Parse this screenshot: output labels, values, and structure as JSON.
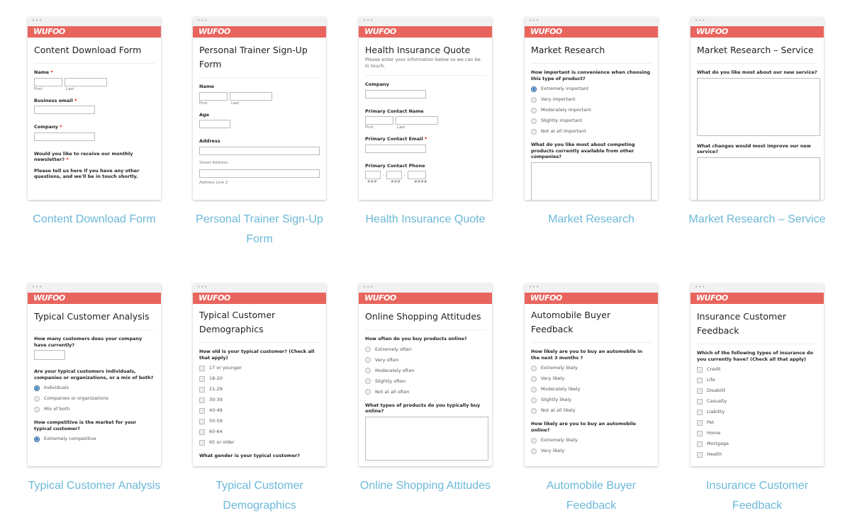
{
  "brand": {
    "logo_text": "WUFOO",
    "bar_color": "#e8655e",
    "caption_color": "#6bb8d8"
  },
  "templates": [
    {
      "caption": "Content Download Form",
      "form_title": "Content Download Form",
      "fields": [
        {
          "label": "Name",
          "required": "*",
          "first": "First",
          "last": "Last"
        },
        {
          "label": "Business email",
          "required": "*"
        },
        {
          "label": "Company",
          "required": "*"
        },
        {
          "label": "Would you like to receive our monthly newsletter?",
          "required": "*"
        },
        {
          "label": "Please tell us here if you have any other questions, and we'll be in touch shortly."
        }
      ]
    },
    {
      "caption": "Personal Trainer Sign-Up Form",
      "form_title": "Personal Trainer Sign-Up Form",
      "fields": [
        {
          "label": "Name",
          "first": "First",
          "last": "Last"
        },
        {
          "label": "Age"
        },
        {
          "label": "Address",
          "street": "Street Address",
          "line2": "Address Line 2"
        }
      ]
    },
    {
      "caption": "Health Insurance Quote",
      "form_title": "Health Insurance Quote",
      "description": "Please enter your information below so we can be in touch.",
      "fields": [
        {
          "label": "Company"
        },
        {
          "label": "Primary Contact Name",
          "first": "First",
          "last": "Last"
        },
        {
          "label": "Primary Contact Email",
          "required": "*"
        },
        {
          "label": "Primary Contact Phone",
          "p1": "###",
          "p2": "###",
          "p3": "####",
          "sep": "-"
        }
      ]
    },
    {
      "caption": "Market Research",
      "form_title": "Market Research",
      "fields": [
        {
          "label": "How important is convenience when choosing this type of product?",
          "options": [
            "Extremely important",
            "Very important",
            "Moderately important",
            "Slightly important",
            "Not at all important"
          ],
          "selected": 0
        },
        {
          "label": "What do you like most about competing products currently available from other companies?"
        }
      ]
    },
    {
      "caption": "Market Research – Service",
      "form_title": "Market Research – Service",
      "fields": [
        {
          "label": "What do you like most about our new service?"
        },
        {
          "label": "What changes would most improve our new service?"
        }
      ]
    },
    {
      "caption": "Typical Customer Analysis",
      "form_title": "Typical Customer Analysis",
      "fields": [
        {
          "label": "How many customers does your company have currently?"
        },
        {
          "label": "Are your typical customers individuals, companies or organizations, or a mix of both?",
          "options": [
            "Individuals",
            "Companies or organizations",
            "Mix of both"
          ],
          "selected": 0
        },
        {
          "label": "How competitive is the market for your typical customer?",
          "options": [
            "Extremely competitive"
          ],
          "selected": 0
        }
      ]
    },
    {
      "caption": "Typical Customer Demographics",
      "form_title": "Typical Customer Demographics",
      "fields": [
        {
          "label": "How old is your typical customer? (Check all that apply)",
          "options": [
            "17 or younger",
            "18-20",
            "21-29",
            "30-39",
            "40-49",
            "50-59",
            "60-64",
            "65 or older"
          ]
        },
        {
          "label": "What gender is your typical customer?"
        }
      ]
    },
    {
      "caption": "Online Shopping Attitudes",
      "form_title": "Online Shopping Attitudes",
      "fields": [
        {
          "label": "How often do you buy products online?",
          "options": [
            "Extremely often",
            "Very often",
            "Moderately often",
            "Slightly often",
            "Not at all often"
          ]
        },
        {
          "label": "What types of products do you typically buy online?"
        }
      ]
    },
    {
      "caption": "Automobile Buyer Feedback",
      "form_title": "Automobile Buyer Feedback",
      "fields": [
        {
          "label": "How likely are you to buy an automobile in the next 3 months ?",
          "options": [
            "Extremely likely",
            "Very likely",
            "Moderately likely",
            "Slightly likely",
            "Not at all likely"
          ]
        },
        {
          "label": "How likely are you to buy an automobile online?",
          "options": [
            "Extremely likely",
            "Very likely"
          ]
        }
      ]
    },
    {
      "caption": "Insurance Customer Feedback",
      "form_title": "Insurance Customer Feedback",
      "fields": [
        {
          "label": "Which of the following types of insurance do you currently have? (Check all that apply)",
          "options": [
            "Credit",
            "Life",
            "Disabilit",
            "Casualty",
            "Liability",
            "Pet",
            "Home",
            "Mortgage",
            "Health"
          ]
        }
      ]
    }
  ]
}
